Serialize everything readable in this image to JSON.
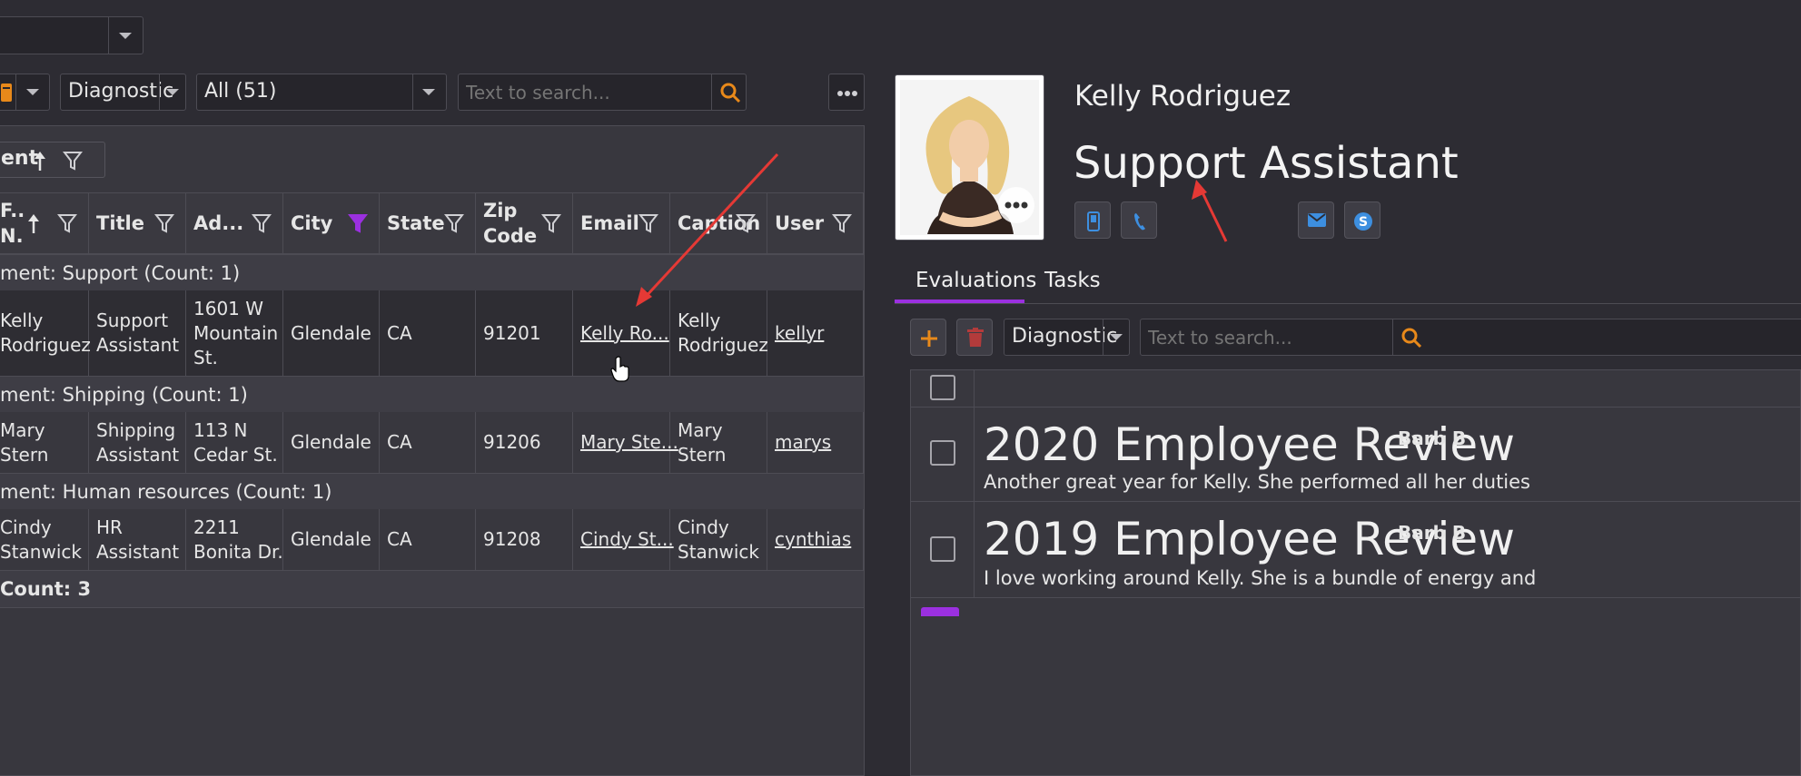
{
  "top_dropdown": {
    "value": ""
  },
  "toolbar": {
    "view_dropdown": "Diagnostic",
    "filter_dropdown": "All (51)",
    "search_placeholder": "Text to search..."
  },
  "group_chip": {
    "label": "ent"
  },
  "columns": [
    {
      "label": "F..\nN.",
      "sorted": true
    },
    {
      "label": "Title"
    },
    {
      "label": "Ad..."
    },
    {
      "label": "City",
      "filtered": true
    },
    {
      "label": "State"
    },
    {
      "label": "Zip\nCode"
    },
    {
      "label": "Email"
    },
    {
      "label": "Caption"
    },
    {
      "label": "User"
    }
  ],
  "groups": [
    {
      "label": "ment: Support (Count: 1)",
      "row": {
        "name": "Kelly\nRodriguez",
        "title": "Support\nAssistant",
        "address": "1601 W\nMountain\nSt.",
        "city": "Glendale",
        "state": "CA",
        "zip": "91201",
        "email": "Kelly Ro...",
        "caption": "Kelly\nRodriguez",
        "user": "kellyr"
      }
    },
    {
      "label": "ment: Shipping (Count: 1)",
      "row": {
        "name": "Mary\nStern",
        "title": "Shipping\nAssistant",
        "address": "113 N\nCedar St.",
        "city": "Glendale",
        "state": "CA",
        "zip": "91206",
        "email": "Mary Ste...",
        "caption": "Mary\nStern",
        "user": "marys"
      }
    },
    {
      "label": "ment: Human resources (Count: 1)",
      "row": {
        "name": "Cindy\nStanwick",
        "title": "HR\nAssistant",
        "address": "2211\nBonita Dr.",
        "city": "Glendale",
        "state": "CA",
        "zip": "91208",
        "email": "Cindy St...",
        "caption": "Cindy\nStanwick",
        "user": "cynthias"
      }
    }
  ],
  "footer": {
    "count": "Count: 3"
  },
  "profile": {
    "name": "Kelly Rodriguez",
    "job_title": "Support Assistant"
  },
  "tabs": {
    "evaluations": "Evaluations",
    "tasks": "Tasks"
  },
  "eval_toolbar": {
    "view_dropdown": "Diagnostic",
    "search_placeholder": "Text to search..."
  },
  "evaluations": [
    {
      "title": "2020 Employee Review",
      "author": "Barb B",
      "text": "Another great year for Kelly. She performed all her duties"
    },
    {
      "title": "2019 Employee Review",
      "author": "Barb B",
      "text": "I love working around Kelly. She is a bundle of energy and"
    }
  ],
  "colors": {
    "accent": "#9b30e0",
    "search": "#e8891a",
    "arrow": "#e53935"
  }
}
